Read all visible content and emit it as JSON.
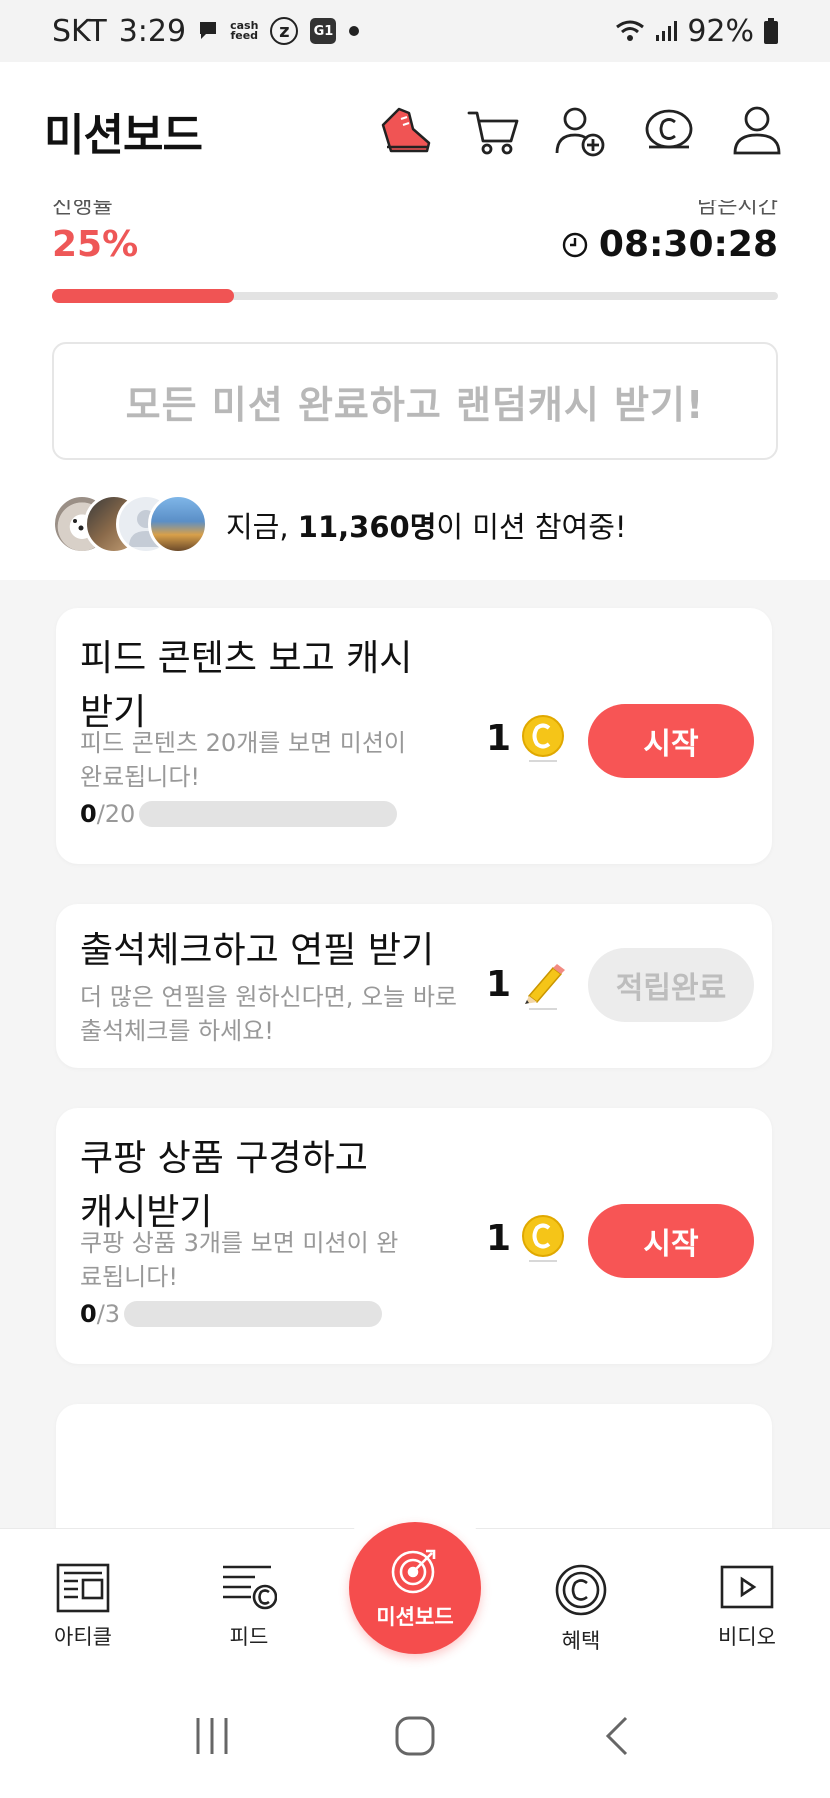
{
  "status_bar": {
    "carrier": "SKT",
    "time": "3:29",
    "cashfeed_icon_text": [
      "cash",
      "feed"
    ],
    "z_icon_text": "z",
    "g_icon_text": "G1",
    "battery": "92%"
  },
  "header": {
    "title": "미션보드",
    "icons": [
      "sneaker-icon",
      "cart-icon",
      "add-friend-icon",
      "coin-icon",
      "profile-icon"
    ]
  },
  "progress": {
    "label": "진행률",
    "percent_text": "25%",
    "percent": 0.25,
    "remaining_label": "남은시간",
    "remaining_time": "08:30:28"
  },
  "banner": {
    "text": "모든 미션 완료하고 랜덤캐시 받기!"
  },
  "participants": {
    "prefix": "지금, ",
    "count": "11,360명",
    "suffix": "이 미션 참여중!"
  },
  "missions": [
    {
      "title": "피드 콘텐츠 보고 캐시받기",
      "desc": "피드 콘텐츠 20개를 보면 미션이 완료됩니다!",
      "progress_current": "0",
      "progress_total": "/20",
      "reward": "1",
      "reward_icon": "cash-coin-icon",
      "button": "시작"
    },
    {
      "title": "출석체크하고 연필 받기",
      "desc": "더 많은 연필을 원하신다면, 오늘 바로 출석체크를 하세요!",
      "reward": "1",
      "reward_icon": "pencil-icon",
      "button": "적립완료"
    },
    {
      "title": "쿠팡 상품 구경하고 캐시받기",
      "desc": "쿠팡 상품 3개를 보면 미션이 완료됩니다!",
      "progress_current": "0",
      "progress_total": "/3",
      "reward": "1",
      "reward_icon": "cash-coin-icon",
      "button": "시작"
    }
  ],
  "bottom_nav": {
    "items": [
      {
        "label": "아티클",
        "icon": "article-icon"
      },
      {
        "label": "피드",
        "icon": "feed-icon"
      },
      {
        "label": "미션보드",
        "icon": "target-icon"
      },
      {
        "label": "혜택",
        "icon": "benefit-icon"
      },
      {
        "label": "비디오",
        "icon": "video-icon"
      }
    ]
  },
  "colors": {
    "accent": "#f54d4d",
    "progress": "#f05454",
    "coin": "#f5c518"
  }
}
